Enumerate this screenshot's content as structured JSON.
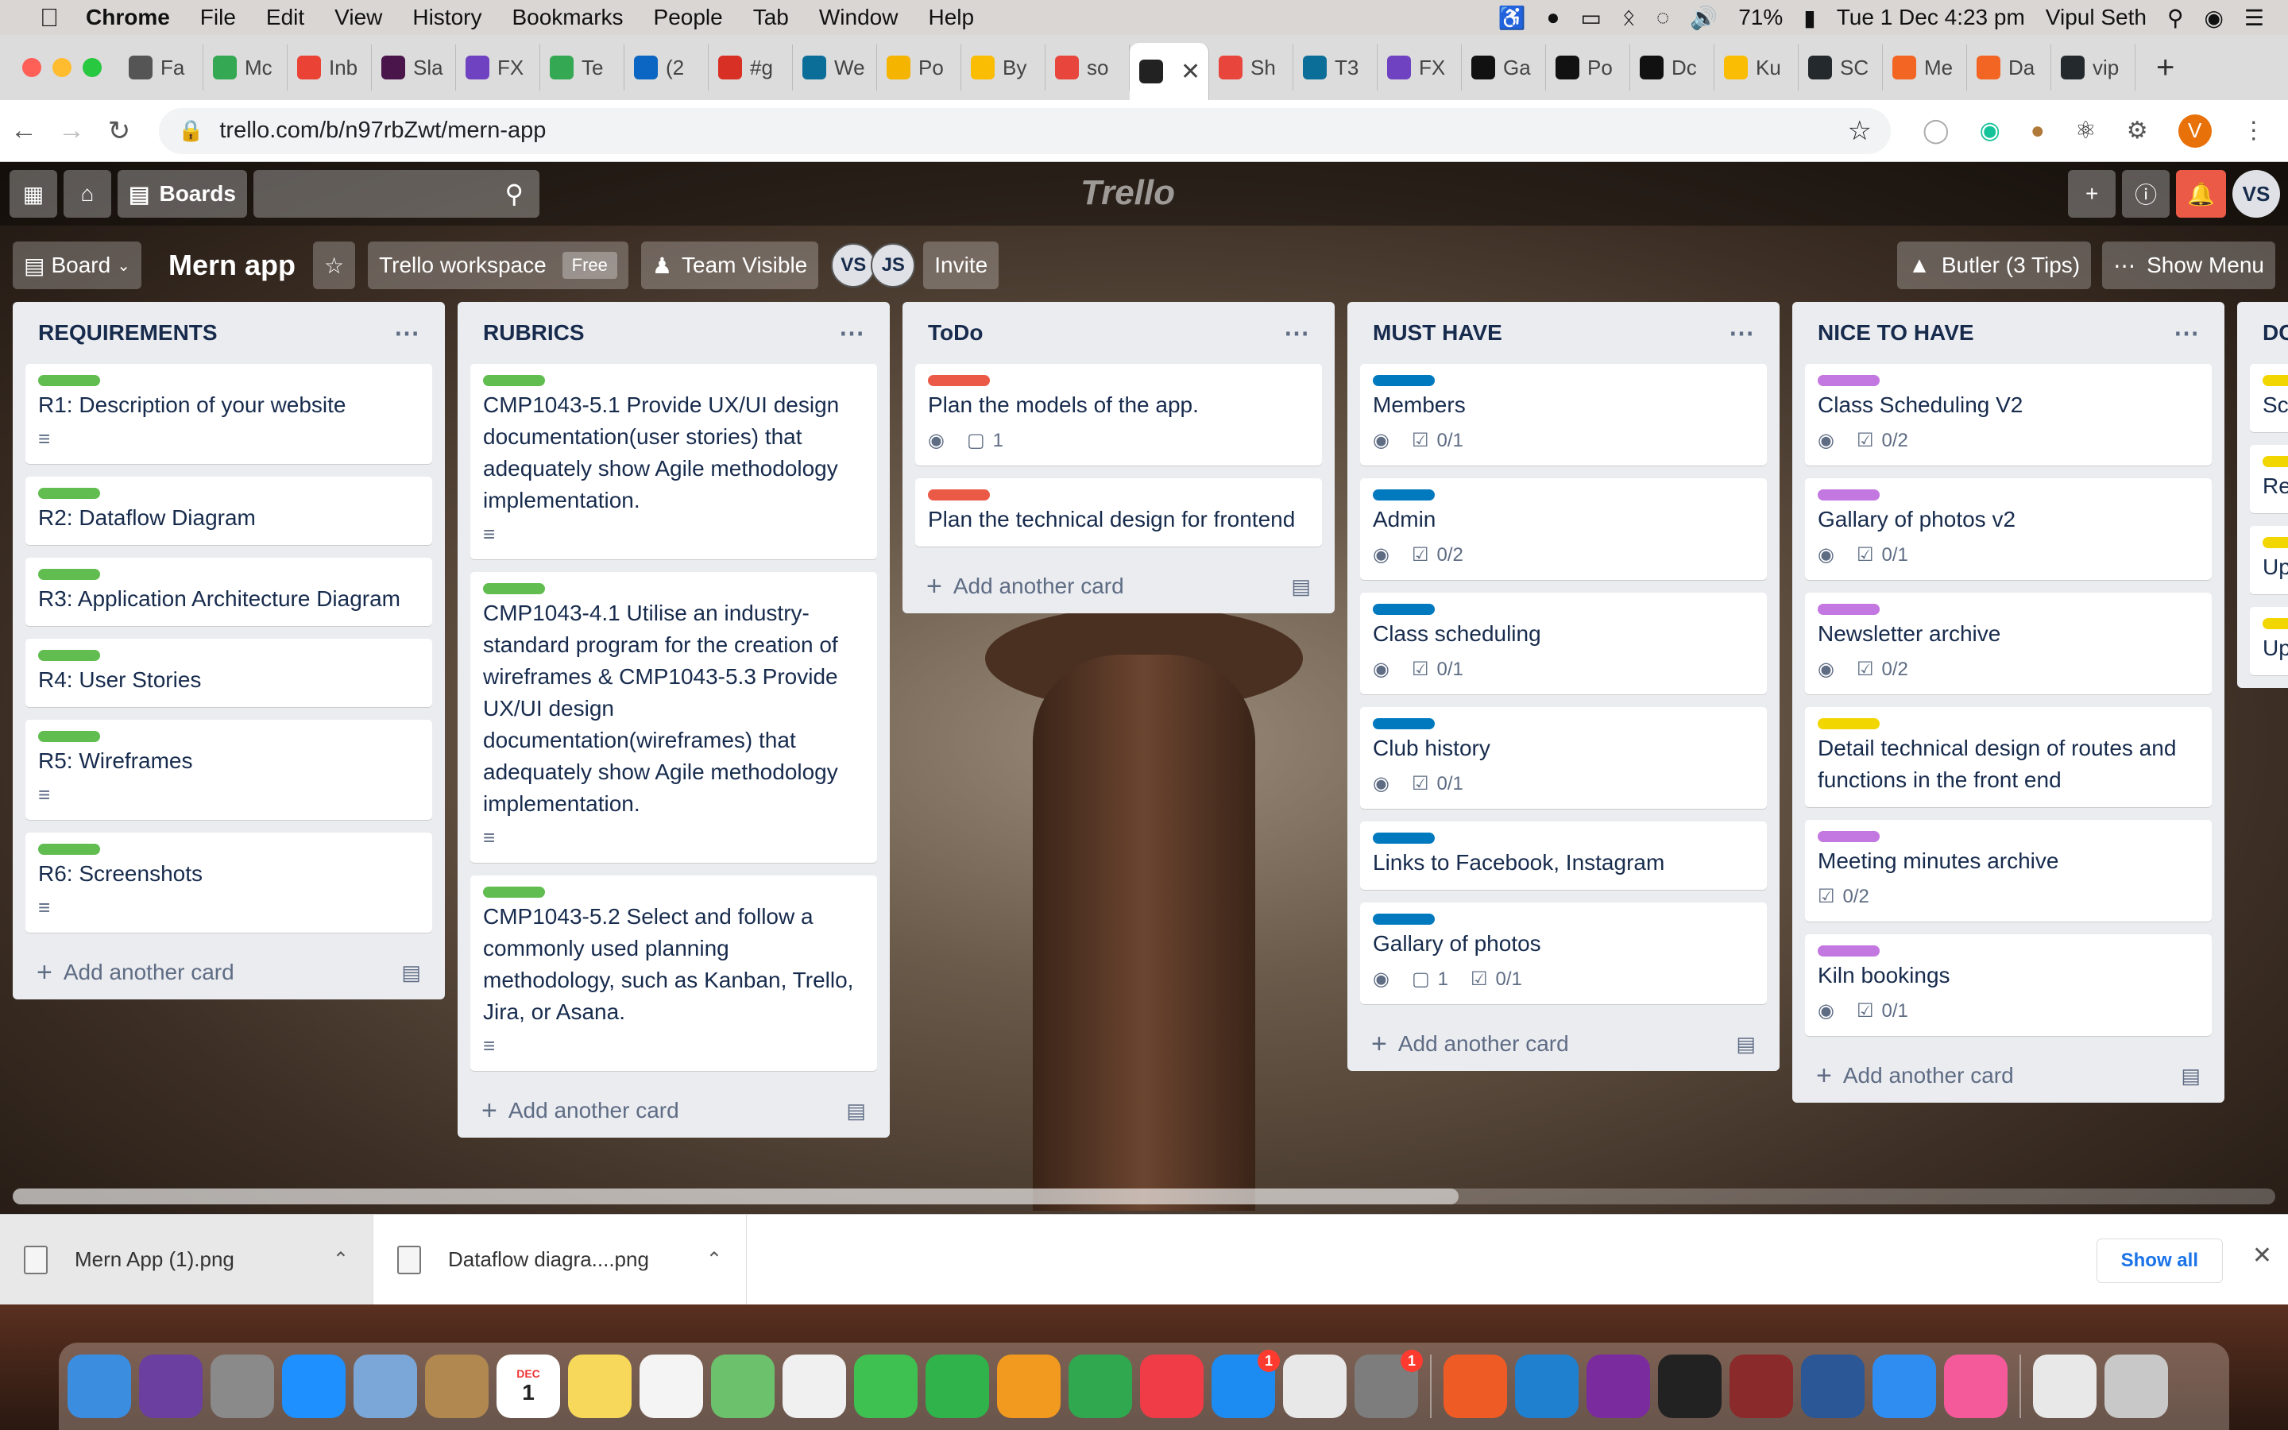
{
  "mac_menu": {
    "app": "Chrome",
    "items": [
      "File",
      "Edit",
      "View",
      "History",
      "Bookmarks",
      "People",
      "Tab",
      "Window",
      "Help"
    ],
    "battery": "71%",
    "clock": "Tue 1 Dec  4:23 pm",
    "user": "Vipul Seth"
  },
  "tabs": [
    {
      "label": "Fa",
      "color": "#555555"
    },
    {
      "label": "Mc",
      "color": "#34a853"
    },
    {
      "label": "Inb",
      "color": "#ea4335"
    },
    {
      "label": "Sla",
      "color": "#4a154b"
    },
    {
      "label": "FX",
      "color": "#6f42c1"
    },
    {
      "label": "Te",
      "color": "#34a853"
    },
    {
      "label": "(2",
      "color": "#0a66c2"
    },
    {
      "label": "#g",
      "color": "#d93025"
    },
    {
      "label": "We",
      "color": "#0b6e99"
    },
    {
      "label": "Po",
      "color": "#f4b400"
    },
    {
      "label": "By",
      "color": "#fbbc04"
    },
    {
      "label": "so",
      "color": "#e8453c"
    },
    {
      "label": "",
      "color": "#222222"
    },
    {
      "label": "Sh",
      "color": "#e8453c"
    },
    {
      "label": "T3",
      "color": "#0b6e99"
    },
    {
      "label": "FX",
      "color": "#6f42c1"
    },
    {
      "label": "Ga",
      "color": "#111111"
    },
    {
      "label": "Po",
      "color": "#111111"
    },
    {
      "label": "Dc",
      "color": "#111111"
    },
    {
      "label": "Ku",
      "color": "#fbbc04"
    },
    {
      "label": "SC",
      "color": "#24292e"
    },
    {
      "label": "Me",
      "color": "#f26522"
    },
    {
      "label": "Da",
      "color": "#f26522"
    },
    {
      "label": "vip",
      "color": "#24292e"
    }
  ],
  "address": {
    "url": "trello.com/b/n97rbZwt/mern-app"
  },
  "profile_initial": "V",
  "trello_header": {
    "boards_label": "Boards",
    "logo": "Trello",
    "avatar": "VS"
  },
  "board": {
    "view_label": "Board",
    "title": "Mern app",
    "workspace": "Trello workspace",
    "workspace_badge": "Free",
    "visibility": "Team Visible",
    "members": [
      "VS",
      "JS"
    ],
    "invite": "Invite",
    "butler": "Butler (3 Tips)",
    "show_menu": "Show Menu"
  },
  "lists": [
    {
      "title": "REQUIREMENTS",
      "cards": [
        {
          "label_color": "#61bd4f",
          "text": "R1: Description of your website",
          "desc": true
        },
        {
          "label_color": "#61bd4f",
          "text": "R2: Dataflow Diagram"
        },
        {
          "label_color": "#61bd4f",
          "text": "R3: Application Architecture Diagram"
        },
        {
          "label_color": "#61bd4f",
          "text": "R4: User Stories"
        },
        {
          "label_color": "#61bd4f",
          "text": "R5: Wireframes",
          "desc": true
        },
        {
          "label_color": "#61bd4f",
          "text": "R6: Screenshots",
          "desc": true
        }
      ],
      "add": "Add another card"
    },
    {
      "title": "RUBRICS",
      "cards": [
        {
          "label_color": "#61bd4f",
          "text": "CMP1043-5.1 Provide UX/UI design documentation(user stories) that adequately show Agile methodology implementation.",
          "desc": true
        },
        {
          "label_color": "#61bd4f",
          "text": "CMP1043-4.1 Utilise an industry-standard program for the creation of wireframes & CMP1043-5.3 Provide UX/UI design documentation(wireframes) that adequately show Agile methodology implementation.",
          "desc": true
        },
        {
          "label_color": "#61bd4f",
          "text": "CMP1043-5.2 Select and follow a commonly used planning methodology, such as Kanban, Trello, Jira, or Asana.",
          "desc": true
        }
      ],
      "add": "Add another card"
    },
    {
      "title": "ToDo",
      "cards": [
        {
          "label_color": "#eb5a46",
          "text": "Plan the models of the app.",
          "watch": true,
          "comments": "1"
        },
        {
          "label_color": "#eb5a46",
          "text": "Plan the technical design for frontend"
        }
      ],
      "add": "Add another card"
    },
    {
      "title": "MUST HAVE",
      "cards": [
        {
          "label_color": "#0079bf",
          "text": "Members",
          "watch": true,
          "checklist": "0/1"
        },
        {
          "label_color": "#0079bf",
          "text": "Admin",
          "watch": true,
          "checklist": "0/2"
        },
        {
          "label_color": "#0079bf",
          "text": "Class scheduling",
          "watch": true,
          "checklist": "0/1"
        },
        {
          "label_color": "#0079bf",
          "text": "Club history",
          "watch": true,
          "checklist": "0/1"
        },
        {
          "label_color": "#0079bf",
          "text": "Links to Facebook, Instagram"
        },
        {
          "label_color": "#0079bf",
          "text": "Gallary of photos",
          "watch": true,
          "comments": "1",
          "checklist": "0/1"
        }
      ],
      "add": "Add another card"
    },
    {
      "title": "NICE TO HAVE",
      "cards": [
        {
          "label_color": "#c377e0",
          "text": "Class Scheduling V2",
          "watch": true,
          "checklist": "0/2"
        },
        {
          "label_color": "#c377e0",
          "text": "Gallary of photos v2",
          "watch": true,
          "checklist": "0/1"
        },
        {
          "label_color": "#c377e0",
          "text": "Newsletter archive",
          "watch": true,
          "checklist": "0/2"
        },
        {
          "label_color": "#f2d600",
          "text": "Detail technical design of routes and functions in the front end"
        },
        {
          "label_color": "#c377e0",
          "text": "Meeting minutes archive",
          "checklist": "0/2"
        },
        {
          "label_color": "#c377e0",
          "text": "Kiln bookings",
          "watch": true,
          "checklist": "0/1"
        }
      ],
      "add": "Add another card"
    },
    {
      "title": "DC",
      "cards": [
        {
          "label_color": "#f2d600",
          "text": "Sc"
        },
        {
          "label_color": "#f2d600",
          "text": "Re"
        },
        {
          "label_color": "#f2d600",
          "text": "Up"
        },
        {
          "label_color": "#f2d600",
          "text": "Up Dia"
        }
      ],
      "add": ""
    }
  ],
  "downloads": {
    "items": [
      "Mern App (1).png",
      "Dataflow diagra....png"
    ],
    "show_all": "Show all"
  },
  "dock": {
    "calendar_month": "DEC",
    "calendar_day": "1",
    "icons": [
      {
        "name": "finder",
        "color": "#3b8de0"
      },
      {
        "name": "siri",
        "color": "#6b3fa0"
      },
      {
        "name": "launchpad",
        "color": "#8a8a8a"
      },
      {
        "name": "safari",
        "color": "#1e90ff"
      },
      {
        "name": "mail",
        "color": "#7aa7d8"
      },
      {
        "name": "contacts",
        "color": "#b08850"
      },
      {
        "name": "calendar",
        "color": "#ffffff"
      },
      {
        "name": "notes",
        "color": "#f7d85a"
      },
      {
        "name": "reminders",
        "color": "#f4f4f4"
      },
      {
        "name": "maps",
        "color": "#6cc26c"
      },
      {
        "name": "photos",
        "color": "#f0f0f0"
      },
      {
        "name": "messages",
        "color": "#3ec150"
      },
      {
        "name": "facetime",
        "color": "#2fb34a"
      },
      {
        "name": "pages",
        "color": "#f29a1f"
      },
      {
        "name": "numbers",
        "color": "#2fa84f"
      },
      {
        "name": "news",
        "color": "#f03c47"
      },
      {
        "name": "app-store",
        "color": "#1c8cf2",
        "badge": "1"
      },
      {
        "name": "chrome",
        "color": "#e8e8e8"
      },
      {
        "name": "system-preferences",
        "color": "#7d7d7d",
        "badge": "1"
      },
      {
        "name": "postman",
        "color": "#ef5b25"
      },
      {
        "name": "vscode",
        "color": "#1f80d0"
      },
      {
        "name": "onenote",
        "color": "#7a2b9e"
      },
      {
        "name": "terminal",
        "color": "#222222"
      },
      {
        "name": "dictionary",
        "color": "#8b2a2a"
      },
      {
        "name": "word",
        "color": "#2b5797"
      },
      {
        "name": "bluetooth",
        "color": "#2f8cf0"
      },
      {
        "name": "itunes",
        "color": "#f45a9a"
      },
      {
        "name": "preview",
        "color": "#e8e8e8"
      },
      {
        "name": "trash",
        "color": "#c8c8c8"
      }
    ]
  }
}
